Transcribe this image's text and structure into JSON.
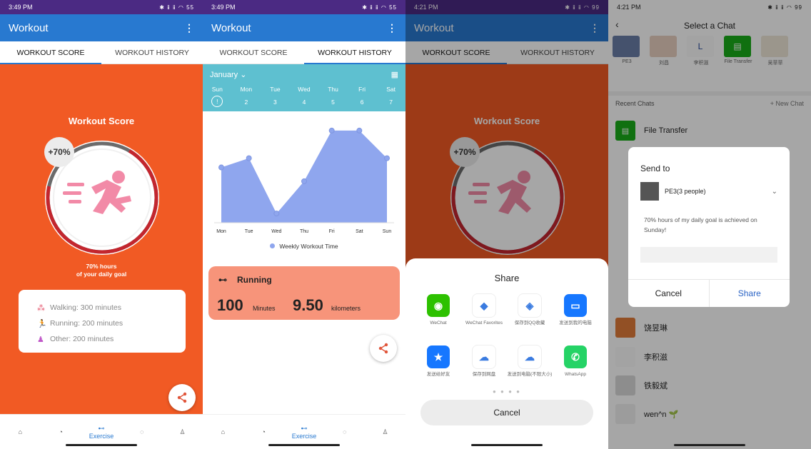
{
  "panel1": {
    "status_time": "3:49 PM",
    "status_icons": "✱ ⅱ ⅱ ◠ 55",
    "app_title": "Workout",
    "tabs": [
      "WORKOUT SCORE",
      "WORKOUT HISTORY"
    ],
    "score_title": "Workout Score",
    "score_badge": "+70%",
    "progress_fraction": 0.7,
    "goal_line1": "70% hours",
    "goal_line2": "of your daily goal",
    "stats": [
      {
        "label": "Walking: 300 minutes",
        "icon": "walking-icon"
      },
      {
        "label": "Running: 200 minutes",
        "icon": "running-icon"
      },
      {
        "label": "Other: 200 minutes",
        "icon": "person-icon"
      }
    ],
    "nav": [
      {
        "label": "",
        "icon": "home-icon"
      },
      {
        "label": "",
        "icon": "pie-chart-icon"
      },
      {
        "label": "Exercise",
        "icon": "dumbbell-icon"
      },
      {
        "label": "",
        "icon": "chat-icon"
      },
      {
        "label": "",
        "icon": "profile-icon"
      }
    ]
  },
  "panel2": {
    "status_time": "3:49 PM",
    "status_icons": "✱ ⅱ ⅱ ◠ 55",
    "app_title": "Workout",
    "tabs": [
      "WORKOUT SCORE",
      "WORKOUT HISTORY"
    ],
    "month": "January",
    "days": [
      {
        "name": "Sun",
        "num": "!"
      },
      {
        "name": "Mon",
        "num": "2"
      },
      {
        "name": "Tue",
        "num": "3"
      },
      {
        "name": "Wed",
        "num": "4"
      },
      {
        "name": "Thu",
        "num": "5"
      },
      {
        "name": "Fri",
        "num": "6"
      },
      {
        "name": "Sat",
        "num": "7"
      }
    ],
    "legend": "Weekly Workout Time",
    "run_title": "Running",
    "run_minutes": "100",
    "run_minutes_unit": "Minutes",
    "run_km": "9.50",
    "run_km_unit": "kilometers",
    "nav_label": "Exercise"
  },
  "chart_data": {
    "type": "area",
    "categories": [
      "Mon",
      "Tue",
      "Wed",
      "Thu",
      "Fri",
      "Sat",
      "Sun"
    ],
    "series": [
      {
        "name": "Weekly Workout Time",
        "values": [
          60,
          70,
          10,
          45,
          100,
          100,
          70
        ]
      }
    ],
    "ylim": [
      0,
      110
    ],
    "grid": false,
    "legend_position": "bottom",
    "color": "#8fa6ee"
  },
  "panel3": {
    "status_time": "4:21 PM",
    "status_icons": "✱ ⅱ ⅱ ◠ 99",
    "app_title": "Workout",
    "tabs": [
      "WORKOUT SCORE",
      "WORKOUT HISTORY"
    ],
    "score_title": "Workout Score",
    "score_badge": "+70%",
    "share_title": "Share",
    "apps": [
      {
        "label": "WeChat",
        "icon": "wechat-icon",
        "color": "#2dc100",
        "glyph": "◉"
      },
      {
        "label": "WeChat Favorites",
        "icon": "wechat-favorites-icon",
        "color": "#ffffff",
        "glyph": "◆"
      },
      {
        "label": "保存到QQ收藏",
        "icon": "qq-favorites-icon",
        "color": "#ffffff",
        "glyph": "◈"
      },
      {
        "label": "发送到我的电脑",
        "icon": "send-to-pc-icon",
        "color": "#1677ff",
        "glyph": "▭"
      },
      {
        "label": "发送给好友",
        "icon": "qq-friend-icon",
        "color": "#1677ff",
        "glyph": "★"
      },
      {
        "label": "保存到网盘",
        "icon": "cloud-drive-icon",
        "color": "#ffffff",
        "glyph": "☁"
      },
      {
        "label": "发送到电脑(不限大小)",
        "icon": "send-to-pc-unlimited-icon",
        "color": "#ffffff",
        "glyph": "☁"
      },
      {
        "label": "WhatsApp",
        "icon": "whatsapp-icon",
        "color": "#25d366",
        "glyph": "✆"
      }
    ],
    "page_dots": "● ● ● ●",
    "cancel": "Cancel"
  },
  "panel4": {
    "status_time": "4:21 PM",
    "status_icons": "✱ ⅱ ⅱ ◠ 99",
    "title": "Select a Chat",
    "contacts": [
      {
        "label": "PE3"
      },
      {
        "label": "刘昌"
      },
      {
        "label": "李积滋"
      },
      {
        "label": "File Transfer"
      },
      {
        "label": "吴菲菲"
      }
    ],
    "recent_label": "Recent Chats",
    "new_chat": "+ New Chat",
    "chats": [
      {
        "name": "File Transfer",
        "top": 168
      },
      {
        "name": "饶昱琳",
        "top": 444
      },
      {
        "name": "李积滋",
        "top": 485
      },
      {
        "name": "铁毅斌",
        "top": 525
      },
      {
        "name": "wen^n 🌱",
        "top": 565
      }
    ],
    "dialog": {
      "send_to": "Send to",
      "target": "PE3(3 people)",
      "message": "70% hours of my daily goal is achieved on Sunday!",
      "cancel": "Cancel",
      "share": "Share"
    }
  }
}
